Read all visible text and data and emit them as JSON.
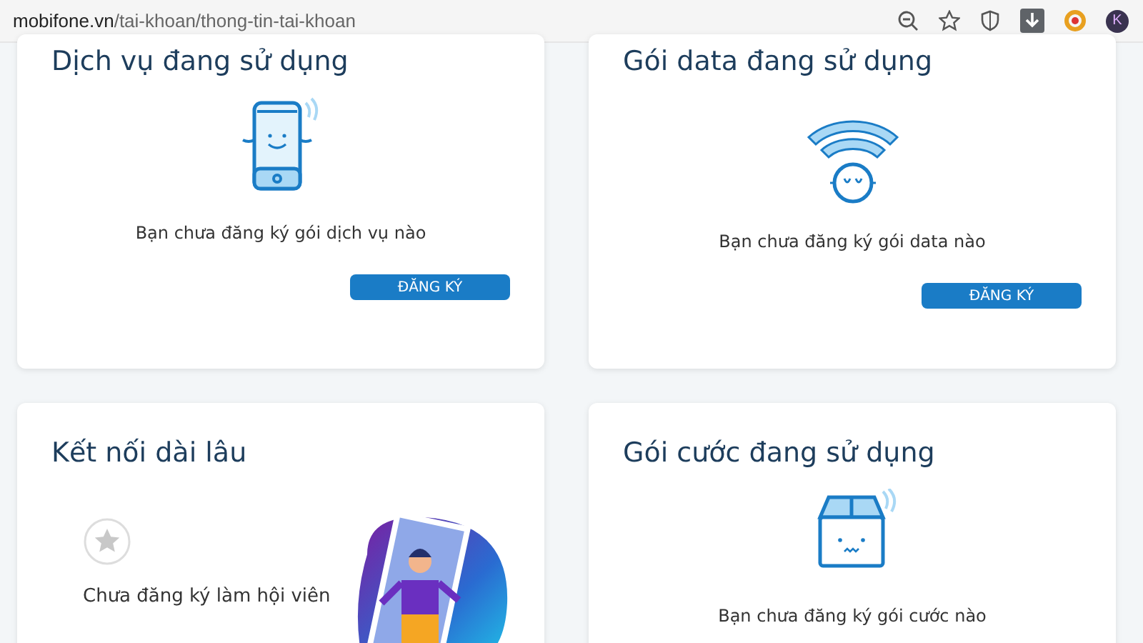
{
  "browser": {
    "url_host": "mobifone.vn",
    "url_path": "/tai-khoan/thong-tin-tai-khoan",
    "profile_initial": "K"
  },
  "cards": [
    {
      "kind": "service",
      "title": "Dịch vụ đang sử dụng",
      "message": "Bạn chưa đăng ký gói dịch vụ nào",
      "button": "ĐĂNG KÝ"
    },
    {
      "kind": "service",
      "title": "Gói data đang sử dụng",
      "message": "Bạn chưa đăng ký gói data nào",
      "button": "ĐĂNG KÝ"
    },
    {
      "kind": "membership",
      "title": "Kết nối dài lâu",
      "message": "Chưa đăng ký làm hội viên"
    },
    {
      "kind": "service",
      "title": "Gói cước đang sử dụng",
      "message": "Bạn chưa đăng ký gói cước nào"
    }
  ]
}
